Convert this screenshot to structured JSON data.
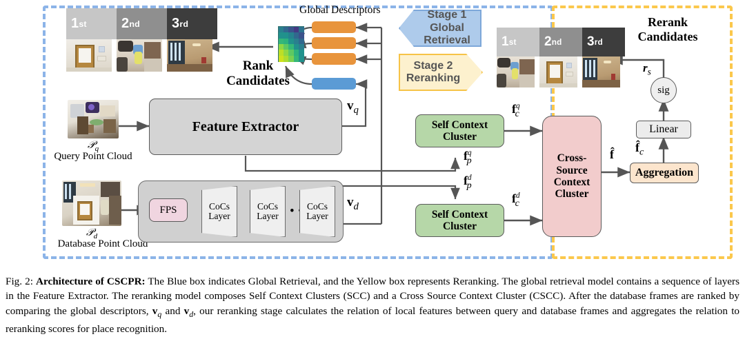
{
  "figure": {
    "number": "Fig. 2:",
    "title": "Architecture of CSCPR:",
    "caption_rest": " The Blue box indicates Global Retrieval, and the Yellow box represents Reranking. The global retrieval model contains a sequence of layers in the Feature Extractor. The reranking model composes Self Context Clusters (SCC) and a Cross Source Context Cluster (CSCC). After the database frames are ranked by comparing the global descriptors, v_q and v_d, our reranking stage calculates the relation of local features between query and database frames and aggregates the relation to reranking scores for place recognition."
  },
  "stages": {
    "stage1": {
      "line1": "Stage 1",
      "line2": "Global Retrieval",
      "color": "#aecbeb",
      "border": "#7da7d9",
      "direction": "left"
    },
    "stage2": {
      "line1": "Stage 2",
      "line2": "Reranking",
      "color": "#fdf1ce",
      "border": "#fbc84c",
      "direction": "right"
    }
  },
  "retrieval": {
    "box_color": "#8cb4e8",
    "rank_candidates_label_l1": "Rank",
    "rank_candidates_label_l2": "Candidates",
    "global_descriptors_label": "Global Descriptors",
    "ranks": [
      {
        "ordinal": "1",
        "suffix": "st",
        "bg": "#c6c6c6"
      },
      {
        "ordinal": "2",
        "suffix": "nd",
        "bg": "#8f8f8f"
      },
      {
        "ordinal": "3",
        "suffix": "rd",
        "bg": "#3d3d3d"
      }
    ],
    "query": {
      "symbol": "P",
      "subscript": "q",
      "caption": "Query Point Cloud"
    },
    "database": {
      "symbol": "P",
      "subscript": "d",
      "caption": "Database Point Cloud"
    },
    "feature_extractor_label": "Feature Extractor",
    "fps_label": "FPS",
    "cocs_layer_label_l1": "CoCs",
    "cocs_layer_label_l2": "Layer",
    "cocs_ellipsis": "• • •",
    "v_q": {
      "vec": "v",
      "sub": "q"
    },
    "v_d": {
      "vec": "v",
      "sub": "d"
    },
    "descriptor_bars": [
      {
        "color": "#e8943c"
      },
      {
        "color": "#e8943c"
      },
      {
        "color": "#e8943c"
      },
      {
        "color": "#5b9bd5"
      }
    ]
  },
  "reranking": {
    "box_color": "#fbc84c",
    "rerank_candidates_label_l1": "Rerank",
    "rerank_candidates_label_l2": "Candidates",
    "ranks": [
      {
        "ordinal": "1",
        "suffix": "st",
        "bg": "#c6c6c6"
      },
      {
        "ordinal": "2",
        "suffix": "nd",
        "bg": "#8f8f8f"
      },
      {
        "ordinal": "3",
        "suffix": "rd",
        "bg": "#3d3d3d"
      }
    ],
    "scc_query_label_l1": "Self Context",
    "scc_query_label_l2": "Cluster",
    "scc_db_label_l1": "Self Context",
    "scc_db_label_l2": "Cluster",
    "cscc_label_l1": "Cross-Source",
    "cscc_label_l2": "Context Cluster",
    "aggregation_label": "Aggregation",
    "linear_label": "Linear",
    "sigmoid_label": "sig",
    "f_p_q": {
      "vec": "f",
      "sub": "p",
      "sup": "q"
    },
    "f_p_d": {
      "vec": "f",
      "sub": "p",
      "sup": "d"
    },
    "f_c_q": {
      "vec": "f",
      "sub": "c",
      "sup": "q"
    },
    "f_c_d": {
      "vec": "f",
      "sub": "c",
      "sup": "d"
    },
    "f_hat": {
      "vec": "f"
    },
    "f_hat_c": {
      "vec": "f",
      "sub": "c"
    },
    "r_s": {
      "vec": "r",
      "sub": "s"
    }
  },
  "heatmap": {
    "type": "heatmap",
    "rows": 6,
    "cols": 5,
    "colors": [
      [
        "#2a7f8e",
        "#31688e",
        "#3b528b",
        "#443a83",
        "#2c728e"
      ],
      [
        "#21918c",
        "#21918c",
        "#26828e",
        "#31688e",
        "#3b528b"
      ],
      [
        "#35b779",
        "#2db27d",
        "#21918c",
        "#2a7f8e",
        "#31688e"
      ],
      [
        "#8fd744",
        "#5ec962",
        "#35b779",
        "#21918c",
        "#2a7f8e"
      ],
      [
        "#bddf26",
        "#8fd744",
        "#5ec962",
        "#2db27d",
        "#21918c"
      ],
      [
        "#cfe11c",
        "#addc30",
        "#7ad151",
        "#35b779",
        "#21918c"
      ]
    ]
  }
}
